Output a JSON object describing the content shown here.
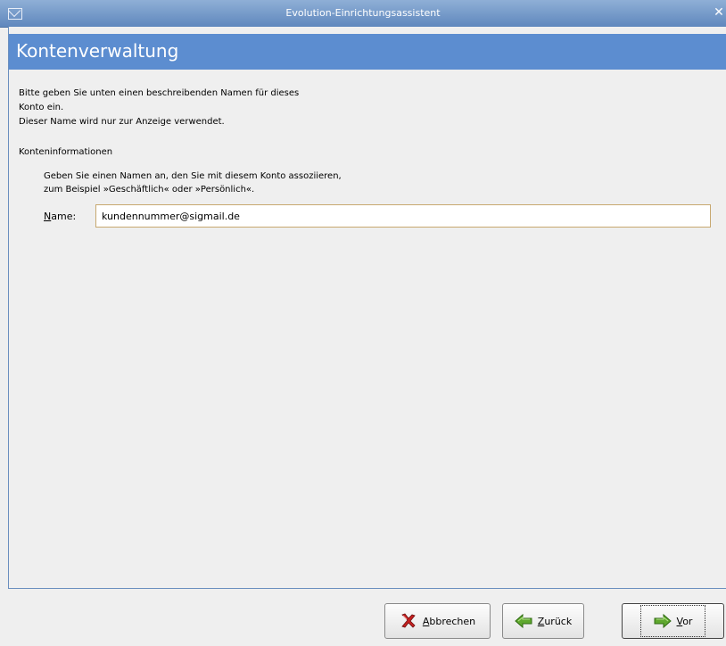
{
  "window": {
    "title": "Evolution-Einrichtungsassistent",
    "close_glyph": "✕"
  },
  "page": {
    "heading": "Kontenverwaltung",
    "intro_line1": "Bitte geben Sie unten einen beschreibenden Namen für dieses",
    "intro_line2": "Konto ein.",
    "intro_line3": "Dieser Name wird nur zur Anzeige verwendet."
  },
  "section": {
    "label": "Konteninformationen",
    "hint_line1": "Geben Sie einen Namen an, den Sie mit diesem Konto assoziieren,",
    "hint_line2": "zum Beispiel »Geschäftlich« oder »Persönlich«."
  },
  "form": {
    "name_label_accel": "N",
    "name_label_rest": "ame:",
    "name_value": "kundennummer@sigmail.de"
  },
  "buttons": {
    "cancel_accel": "A",
    "cancel_rest": "bbrechen",
    "back_accel": "Z",
    "back_rest": "urück",
    "next_accel": "V",
    "next_rest": "or"
  },
  "icons": {
    "window": "mail-envelope-icon",
    "cancel": "cancel-x-icon",
    "back": "arrow-left-icon",
    "next": "arrow-right-icon"
  },
  "colors": {
    "header_band": "#5c8dd0",
    "arrow_green": "#5fa82e",
    "cancel_red": "#c62020"
  }
}
